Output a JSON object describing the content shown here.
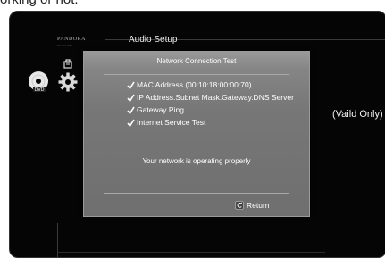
{
  "page": {
    "top_caption": "orking or not."
  },
  "menu": {
    "brand": "PANDORA",
    "brand_sub": "internet radio",
    "title": "Audio Setup",
    "side_text": "(Vaild Only)"
  },
  "dialog": {
    "title": "Network Connection Test",
    "checks": [
      {
        "label": "MAC Address (00:10:18:00:00:70)"
      },
      {
        "label": "IP Address.Subnet Mask.Gateway.DNS Server"
      },
      {
        "label": "Gateway Ping"
      },
      {
        "label": "Internet Service Test"
      }
    ],
    "status": "Your network is operating properly",
    "return_label": "Return"
  },
  "icons": {
    "check": "check-icon",
    "return": "return-icon",
    "disc": "disc-icon",
    "gear": "gear-icon",
    "small": "menu-item-icon"
  },
  "colors": {
    "screen_bg": "#050505",
    "dialog_bg": "#777777",
    "text": "#ffffff"
  }
}
